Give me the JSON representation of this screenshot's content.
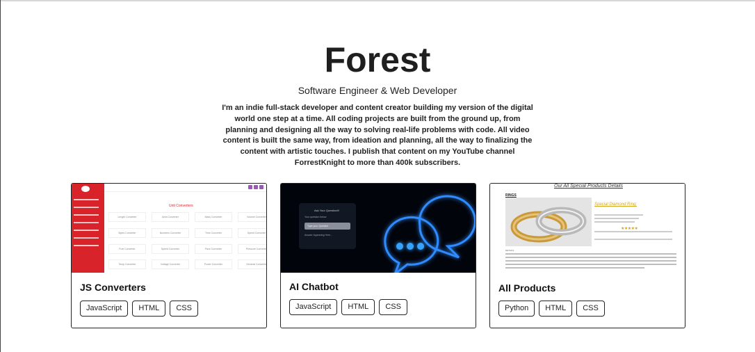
{
  "hero": {
    "title": "Forest",
    "subtitle": "Software Engineer & Web Developer",
    "bio": "I'm an indie full-stack developer and content creator building my version of the digital world one step at a time. All coding projects are built from the ground up, from planning and designing all the way to solving real-life problems with code. All video content is built the same way, from ideation and planning, all the way to finalizing the content with artistic touches. I publish that content on my YouTube channel ForrestKnight to more than 400k subscribers."
  },
  "projects": [
    {
      "title": "JS Converters",
      "tags": [
        "JavaScript",
        "HTML",
        "CSS"
      ],
      "thumbnail": {
        "heading": "Unit Converters",
        "cells": [
          "Length Converter",
          "Area Converter",
          "Mass Converter",
          "Volume Converter",
          "Bytes Converter",
          "Numbers Converter",
          "Time Converter",
          "Speed Converter",
          "Fuel Converter",
          "Speed Converter",
          "Pace Converter",
          "Pressure Converter",
          "Temp Converter",
          "Voltage Converter",
          "Power Converter",
          "Decimal Converter"
        ]
      }
    },
    {
      "title": "AI Chatbot",
      "tags": [
        "JavaScript",
        "HTML",
        "CSS"
      ],
      "thumbnail": {
        "box_title": "Ask Your Question!!!",
        "box_label": "Your question below",
        "box_input": "Type your Question",
        "box_answer": "Answer Appearing Here..."
      }
    },
    {
      "title": "All Products",
      "tags": [
        "Python",
        "HTML",
        "CSS"
      ],
      "thumbnail": {
        "heading": "Our All Special Products Details",
        "section": "RINGS",
        "product_title": "Special Diamond Ring:",
        "details_label": "DETAILS"
      }
    }
  ],
  "colors": {
    "text": "#222222",
    "converter_red": "#d9232b",
    "chatbot_glow": "#1e90ff",
    "gold": "#d4a514"
  }
}
